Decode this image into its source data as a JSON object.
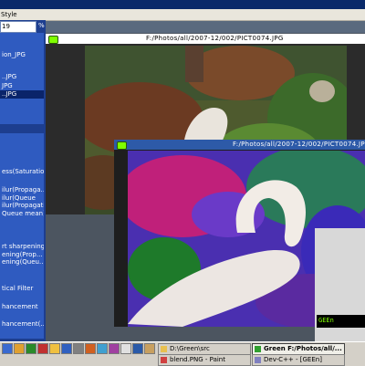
{
  "window": {
    "title": "Style"
  },
  "menubar": {
    "label": "Style"
  },
  "toolbar": {
    "zoom_value": "19",
    "zoom_unit": "%"
  },
  "file_list": [
    {
      "label": "ion_JPG",
      "selected": false
    },
    {
      "label": "",
      "selected": false
    },
    {
      "label": "",
      "selected": false
    },
    {
      "label": "..JPG",
      "selected": false
    },
    {
      "label": "JPG",
      "selected": false
    },
    {
      "label": "",
      "selected": false
    },
    {
      "label": "..JPG",
      "selected": true
    }
  ],
  "operations": [
    "",
    "",
    "ess(Saturation",
    "",
    "ilur(Propaga...",
    "ilur(Queue",
    "ilur(Propagative)",
    "Queue mean)",
    "",
    "",
    "rt sharpening",
    "ening(Prop...",
    "ening(Queu...",
    "",
    "",
    "tical Filter",
    "",
    "hancement",
    "",
    "hancement(..."
  ],
  "back_window": {
    "title": "F:/Photos/all/2007-12/002/PICT0074.JPG"
  },
  "front_window": {
    "title": "F:/Photos/all/2007-12/002/PICT0074.JPG"
  },
  "console": {
    "text": "GEEn"
  },
  "taskbar": {
    "tasks": [
      {
        "label": "D:\\Green\\src",
        "active": false
      },
      {
        "label": "Green F:/Photos/all/...",
        "active": true
      },
      {
        "label": "blend.PNG - Paint",
        "active": false
      },
      {
        "label": "Dev-C++ - [GEEn]",
        "active": false
      }
    ]
  },
  "colors": {
    "panel_blue": "#2f5bc0",
    "title_active": "#2d5aa8",
    "accent_green": "#7fff00"
  }
}
